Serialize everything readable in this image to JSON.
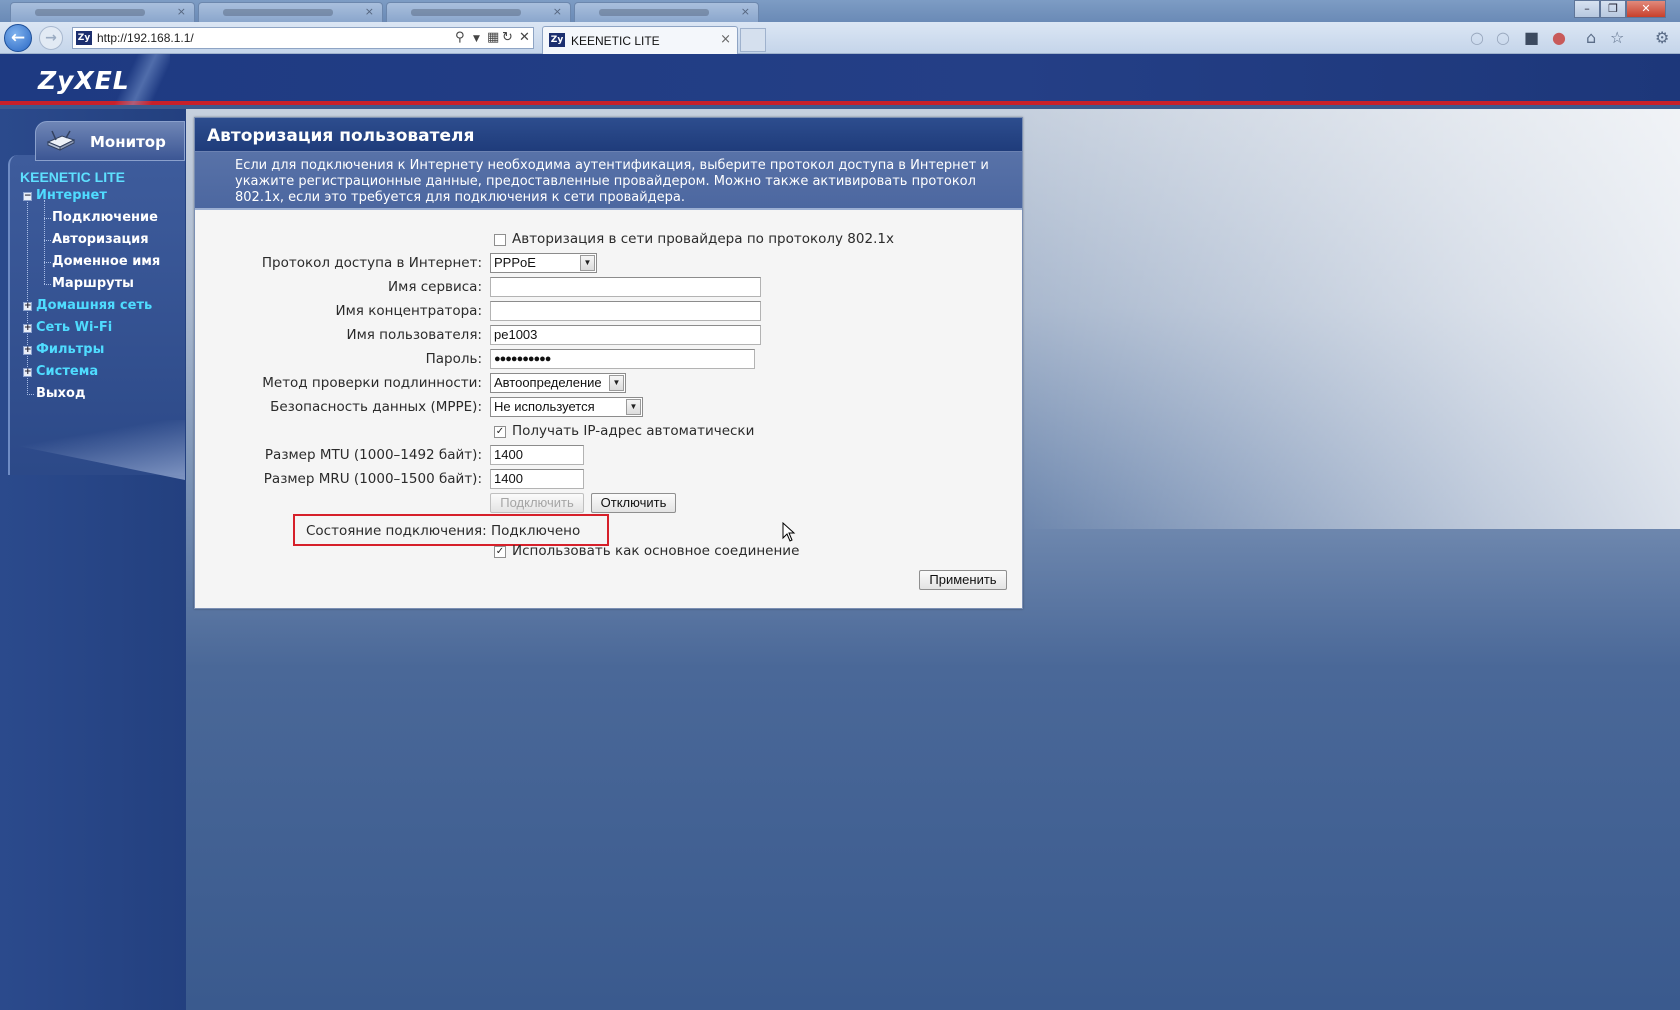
{
  "browser": {
    "url": "http://192.168.1.1/",
    "active_tab_title": "KEENETIC LITE",
    "favicon_text": "Zy",
    "tab_close": "×",
    "win_minimize": "–",
    "win_restore": "❐",
    "win_close": "✕"
  },
  "header": {
    "logo": "ZyXEL"
  },
  "sidebar": {
    "monitor_label": "Монитор",
    "product_name": "KEENETIC LITE",
    "items": [
      {
        "label": "Интернет",
        "expanded": true,
        "toggle": "−"
      },
      {
        "label": "Домашняя сеть",
        "toggle": "+"
      },
      {
        "label": "Сеть Wi-Fi",
        "toggle": "+"
      },
      {
        "label": "Фильтры",
        "toggle": "+"
      },
      {
        "label": "Система",
        "toggle": "+"
      },
      {
        "label": "Выход"
      }
    ],
    "internet_children": [
      "Подключение",
      "Авторизация",
      "Доменное имя",
      "Маршруты"
    ]
  },
  "panel": {
    "title": "Авторизация пользователя",
    "description": "Если для подключения к Интернету необходима аутентификация, выберите протокол доступа в Интернет и укажите регистрационные данные, предоставленные провайдером. Можно также активировать протокол 802.1x, если это требуется для подключения к сети провайдера."
  },
  "form": {
    "auth_8021x": {
      "label": "Авторизация в сети провайдера по протоколу 802.1x",
      "checked": false
    },
    "protocol": {
      "label": "Протокол доступа в Интернет:",
      "value": "PPPoE"
    },
    "service_name": {
      "label": "Имя сервиса:",
      "value": ""
    },
    "concentrator_name": {
      "label": "Имя концентратора:",
      "value": ""
    },
    "username": {
      "label": "Имя пользователя:",
      "value": "pe1003"
    },
    "password": {
      "label": "Пароль:",
      "value": "●●●●●●●●●●"
    },
    "auth_method": {
      "label": "Метод проверки подлинности:",
      "value": "Автоопределение"
    },
    "data_security": {
      "label": "Безопасность данных (MPPE):",
      "value": "Не используется"
    },
    "auto_ip": {
      "label": "Получать IP-адрес автоматически",
      "checked": true
    },
    "mtu": {
      "label": "Размер MTU (1000–1492 байт):",
      "value": "1400"
    },
    "mru": {
      "label": "Размер MRU (1000–1500 байт):",
      "value": "1400"
    },
    "connect_button": "Подключить",
    "disconnect_button": "Отключить",
    "status_text": "Состояние подключения: Подключено",
    "primary_connection": {
      "label": "Использовать как основное соединение",
      "checked": true
    },
    "apply_button": "Применить",
    "check_mark": "✓",
    "dropdown_arrow": "▼"
  }
}
